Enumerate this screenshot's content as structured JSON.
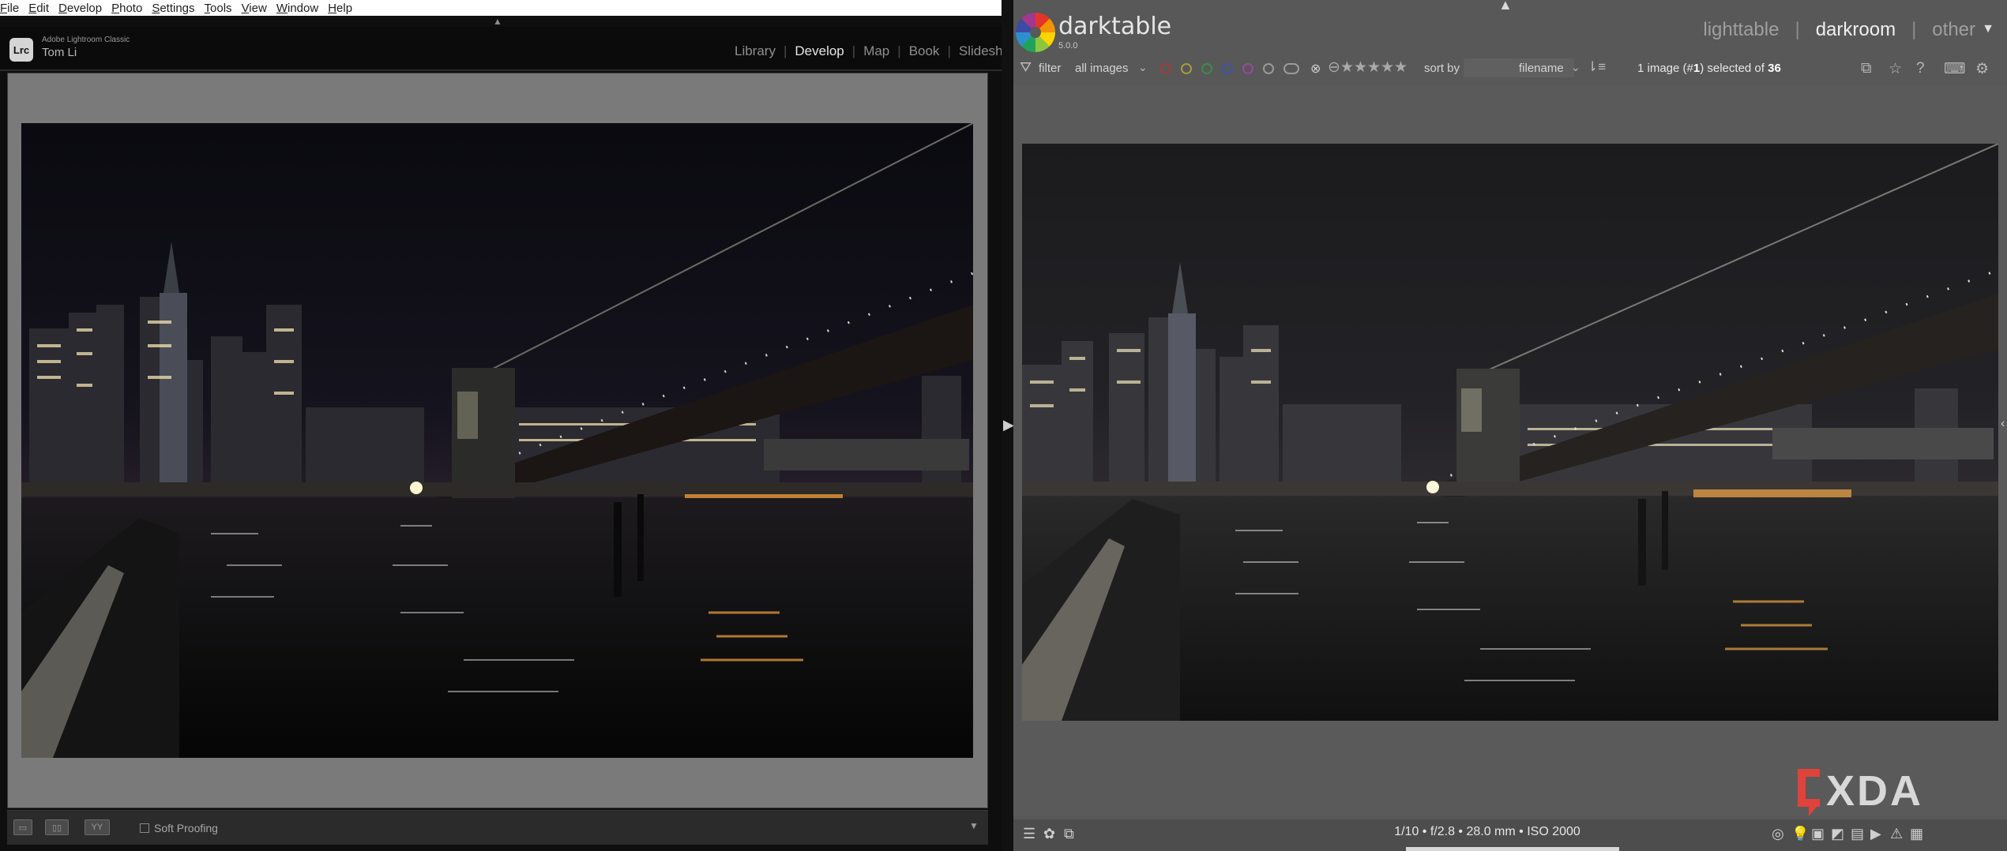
{
  "lightroom": {
    "menubar": {
      "items": [
        {
          "label": "File",
          "accel": "F",
          "rest": "ile"
        },
        {
          "label": "Edit",
          "accel": "E",
          "rest": "dit"
        },
        {
          "label": "Develop",
          "accel": "D",
          "rest": "evelop"
        },
        {
          "label": "Photo",
          "accel": "P",
          "rest": "hoto"
        },
        {
          "label": "Settings",
          "accel": "S",
          "rest": "ettings"
        },
        {
          "label": "Tools",
          "accel": "T",
          "rest": "ools"
        },
        {
          "label": "View",
          "accel": "V",
          "rest": "iew"
        },
        {
          "label": "Window",
          "accel": "W",
          "rest": "indow"
        },
        {
          "label": "Help",
          "accel": "H",
          "rest": "elp"
        }
      ]
    },
    "identity": {
      "logo_text": "Lrc",
      "app_name": "Adobe Lightroom Classic",
      "user": "Tom Li"
    },
    "modules": {
      "items": [
        "Library",
        "Develop",
        "Map",
        "Book",
        "Slidesho"
      ],
      "active": "Develop"
    },
    "toolbar": {
      "soft_proofing_label": "Soft Proofing",
      "soft_proofing_checked": false,
      "compare_label": "YY"
    }
  },
  "darktable": {
    "title": "darktable",
    "version": "5.0.0",
    "views": {
      "items": [
        "lighttable",
        "darkroom",
        "other"
      ],
      "active": "darkroom"
    },
    "filter": {
      "label": "filter",
      "value": "all images"
    },
    "color_labels": [
      "#a23c3c",
      "#a89a3a",
      "#3e8c45",
      "#3e54a8",
      "#9a46a3"
    ],
    "rating_stars": "★★★★★",
    "sort": {
      "label": "sort by",
      "value": "filename"
    },
    "selection": {
      "prefix": "1 image (#",
      "index": "1",
      "middle": ") selected of ",
      "total": "36"
    },
    "exif": "1/10 • f/2.8 • 28.0 mm • ISO 2000"
  },
  "watermark": {
    "text": "XDA"
  },
  "colors": {
    "lr_bg": "#0e0e0e",
    "lr_canvas": "#7a7a7a",
    "dt_bg": "#585858",
    "dt_text": "#e6e6e6",
    "xda_red": "#e0423c"
  }
}
